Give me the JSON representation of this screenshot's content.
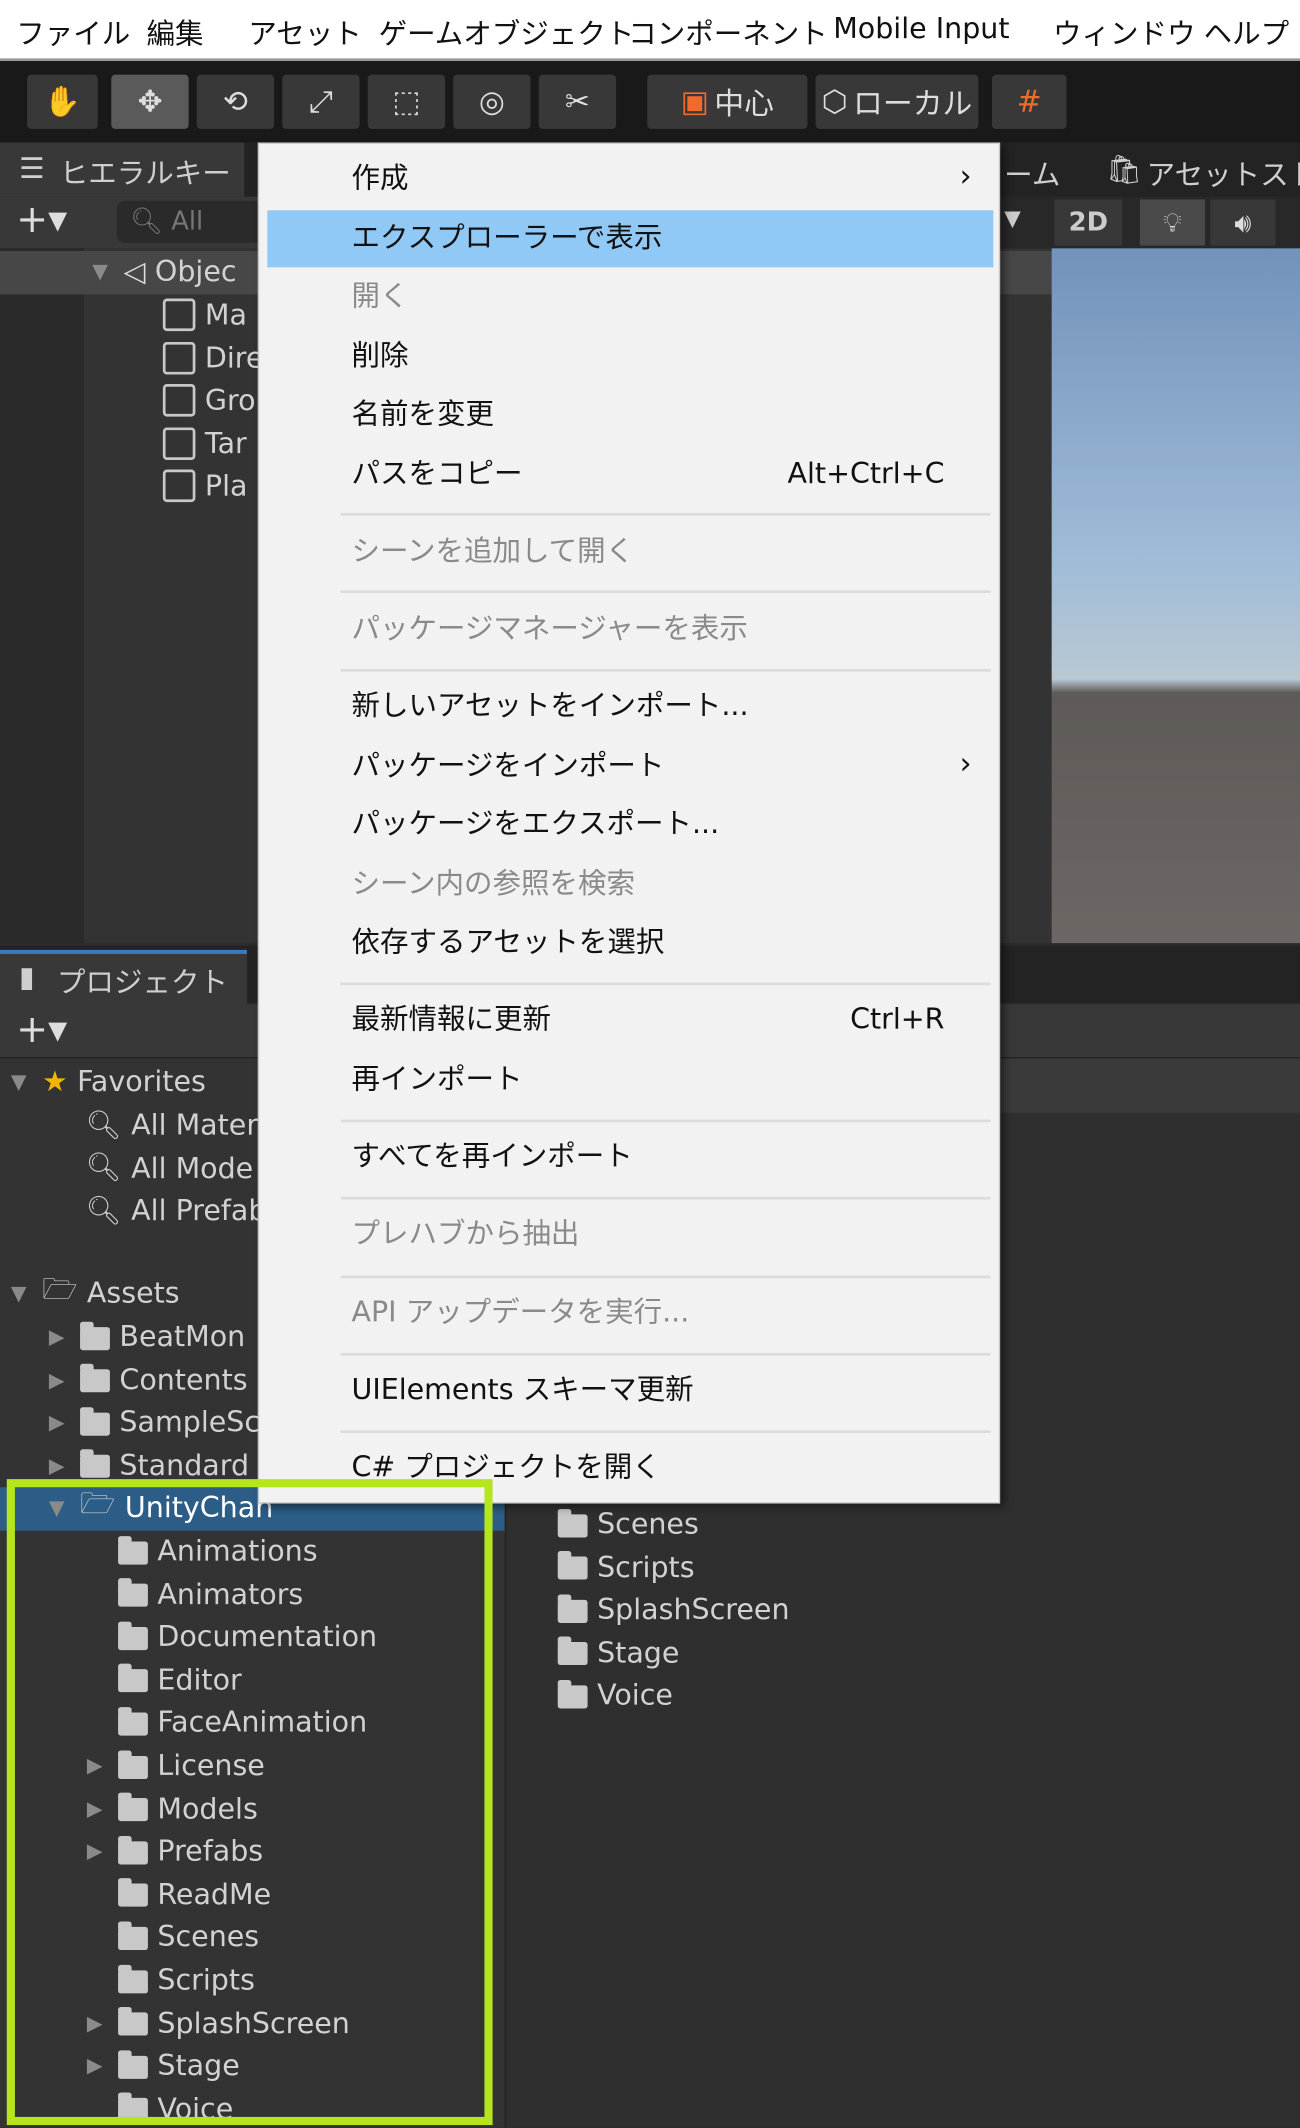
{
  "menubar": [
    "ファイル",
    "編集",
    "アセット",
    "ゲームオブジェクト",
    "コンポーネント",
    "Mobile Input",
    "ウィンドウ",
    "ヘルプ"
  ],
  "toolbar": {
    "pivot": "中心",
    "space": "ローカル"
  },
  "hierarchy": {
    "tab": "ヒエラルキー",
    "search_placeholder": "All",
    "scene_root": "Objec",
    "items": [
      "Ma",
      "Dire",
      "Gro",
      "Tar",
      "Pla"
    ]
  },
  "scene_tabs": {
    "game": "ーム",
    "asset_store": "アセットスト",
    "mode_2d": "2D"
  },
  "project": {
    "tab": "プロジェクト",
    "favorites": {
      "label": "Favorites",
      "items": [
        "All Mater",
        "All Mode",
        "All Prefab"
      ]
    },
    "assets": {
      "label": "Assets",
      "items": [
        "BeatMon",
        "Contents",
        "SampleSc",
        "Standard"
      ]
    },
    "selected": "UnityChan",
    "children": [
      {
        "n": "Animations",
        "e": false
      },
      {
        "n": "Animators",
        "e": false
      },
      {
        "n": "Documentation",
        "e": false
      },
      {
        "n": "Editor",
        "e": false
      },
      {
        "n": "FaceAnimation",
        "e": false
      },
      {
        "n": "License",
        "e": true
      },
      {
        "n": "Models",
        "e": true
      },
      {
        "n": "Prefabs",
        "e": true
      },
      {
        "n": "ReadMe",
        "e": false
      },
      {
        "n": "Scenes",
        "e": false
      },
      {
        "n": "Scripts",
        "e": false
      },
      {
        "n": "SplashScreen",
        "e": true
      },
      {
        "n": "Stage",
        "e": true
      },
      {
        "n": "Voice",
        "e": false
      }
    ],
    "right_items": [
      "Scenes",
      "Scripts",
      "SplashScreen",
      "Stage",
      "Voice"
    ]
  },
  "context_menu": [
    {
      "label": "作成",
      "sub": true
    },
    {
      "label": "エクスプローラーで表示",
      "highlight": true
    },
    {
      "label": "開く",
      "disabled": true
    },
    {
      "label": "削除"
    },
    {
      "label": "名前を変更"
    },
    {
      "label": "パスをコピー",
      "shortcut": "Alt+Ctrl+C",
      "sep": true
    },
    {
      "label": "シーンを追加して開く",
      "disabled": true,
      "sep": true
    },
    {
      "label": "パッケージマネージャーを表示",
      "disabled": true,
      "sep": true
    },
    {
      "label": "新しいアセットをインポート..."
    },
    {
      "label": "パッケージをインポート",
      "sub": true
    },
    {
      "label": "パッケージをエクスポート..."
    },
    {
      "label": "シーン内の参照を検索",
      "disabled": true
    },
    {
      "label": "依存するアセットを選択",
      "sep": true
    },
    {
      "label": "最新情報に更新",
      "shortcut": "Ctrl+R"
    },
    {
      "label": "再インポート",
      "sep": true
    },
    {
      "label": "すべてを再インポート",
      "sep": true
    },
    {
      "label": "プレハブから抽出",
      "disabled": true,
      "sep": true
    },
    {
      "label": "API アップデータを実行...",
      "disabled": true,
      "sep": true
    },
    {
      "label": "UIElements スキーマ更新",
      "sep": true
    },
    {
      "label": "C# プロジェクトを開く"
    }
  ],
  "colors": {
    "highlight": "#90c8f6",
    "selection": "#2c5d87",
    "annotation": "#b5e61d"
  }
}
